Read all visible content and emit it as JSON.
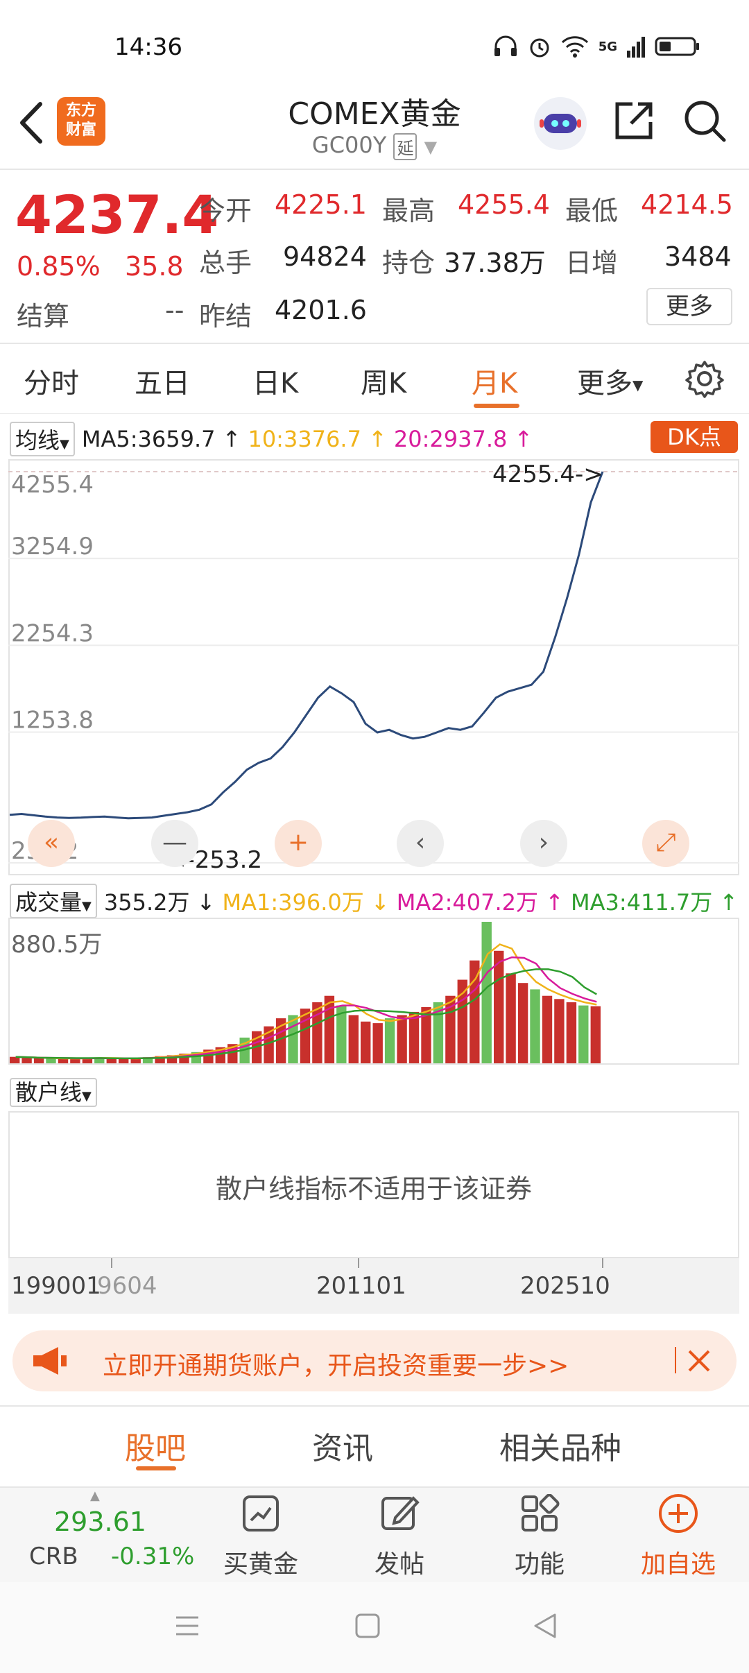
{
  "status": {
    "time": "14:36",
    "network": "5G"
  },
  "header": {
    "title": "COMEX黄金",
    "code": "GC00Y",
    "delay_badge": "延",
    "logo_text": "东方财富"
  },
  "quote": {
    "price": "4237.4",
    "change_pct": "0.85%",
    "change": "35.8",
    "open_label": "今开",
    "open": "4225.1",
    "high_label": "最高",
    "high": "4255.4",
    "low_label": "最低",
    "low": "4214.5",
    "volume_label": "总手",
    "volume": "94824",
    "oi_label": "持仓",
    "oi": "37.38万",
    "daily_inc_label": "日增",
    "daily_inc": "3484",
    "settle_label": "结算",
    "settle": "--",
    "prev_settle_label": "昨结",
    "prev_settle": "4201.6",
    "more": "更多"
  },
  "tabs": [
    "分时",
    "五日",
    "日K",
    "周K",
    "月K",
    "更多"
  ],
  "active_tab": "月K",
  "ma": {
    "selector": "均线",
    "ma5": "MA5:3659.7",
    "ma10": "10:3376.7",
    "ma20": "20:2937.8",
    "dk_button": "DK点"
  },
  "colors": {
    "accent": "#e8702a",
    "up": "#e0292c",
    "down": "#2e9e2e",
    "ma10": "#f0b31a",
    "ma20": "#d81b9b",
    "line": "#2c4a7a"
  },
  "chart_data": {
    "type": "line",
    "series": [
      {
        "values": [
          300,
          310,
          295,
          280,
          270,
          265,
          268,
          275,
          280,
          270,
          260,
          265,
          270,
          290,
          310,
          330,
          360,
          420,
          560,
          680,
          820,
          900,
          950,
          1080,
          1250,
          1450,
          1650,
          1780,
          1700,
          1600,
          1350,
          1250,
          1280,
          1220,
          1180,
          1200,
          1250,
          1300,
          1280,
          1320,
          1480,
          1650,
          1720,
          1760,
          1800,
          1950,
          2350,
          2800,
          3300,
          3900,
          4255.4
        ]
      }
    ],
    "ylim": [
      -253.2,
      4255.4
    ],
    "y_ticks": [
      "4255.4",
      "3254.9",
      "2254.3",
      "1253.8",
      "253.2"
    ],
    "max_annotation": "4255.4->",
    "min_annotation": "<-253.2",
    "x_ticks": [
      "199001",
      "9604",
      "201101",
      "202510"
    ]
  },
  "chart_controls": [
    "«",
    "—",
    "+",
    "‹",
    "›",
    "⤢"
  ],
  "volume": {
    "selector": "成交量",
    "current": "355.2万",
    "ma1": "MA1:396.0万",
    "ma2": "MA2:407.2万",
    "ma3": "MA3:411.7万",
    "max_label": "880.5万"
  },
  "volume_data": {
    "type": "bar",
    "values": [
      40,
      35,
      30,
      32,
      28,
      30,
      33,
      35,
      30,
      28,
      32,
      38,
      45,
      50,
      60,
      70,
      85,
      100,
      120,
      160,
      200,
      230,
      280,
      300,
      340,
      380,
      420,
      360,
      300,
      260,
      250,
      280,
      300,
      320,
      350,
      380,
      420,
      520,
      640,
      880.5,
      700,
      560,
      500,
      460,
      420,
      400,
      380,
      360,
      355.2
    ],
    "ylim": [
      0,
      880.5
    ]
  },
  "retail": {
    "selector": "散户线",
    "message": "散户线指标不适用于该证券"
  },
  "banner": {
    "text": "立即开通期货账户，开启投资重要一步>>"
  },
  "bottom_tabs": [
    "股吧",
    "资讯",
    "相关品种"
  ],
  "active_bottom_tab": "股吧",
  "toolbar": {
    "crb_value": "293.61",
    "crb_label": "CRB",
    "crb_change": "-0.31%",
    "buy_gold": "买黄金",
    "post": "发帖",
    "functions": "功能",
    "add_watch": "加自选"
  }
}
